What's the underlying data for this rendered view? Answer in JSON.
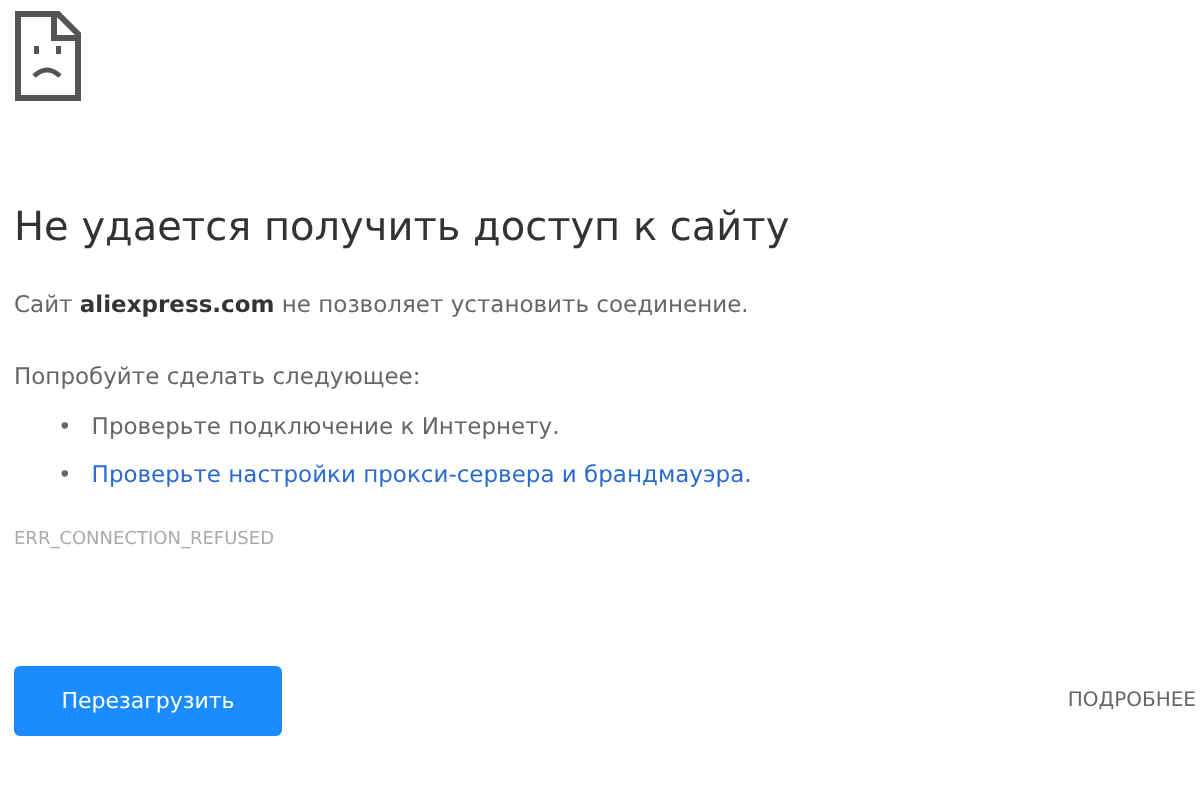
{
  "heading": "Не удается получить доступ к сайту",
  "message": "Сайт **aliexpress.com** не позволяет установить соединение.",
  "suggestions_title": "Попробуйте сделать следующее:",
  "suggestions": [
    {
      "kind": "text",
      "bullet": "•",
      "text": "Проверьте подключение к Интернету."
    },
    {
      "kind": "link",
      "bullet": "•",
      "text": "Проверьте настройки прокси-сервера и брандмауэра."
    }
  ],
  "error_code": "ERR_CONNECTION_REFUSED",
  "reload_button": "Перезагрузить",
  "details_button": "ПОДРОБНЕЕ"
}
